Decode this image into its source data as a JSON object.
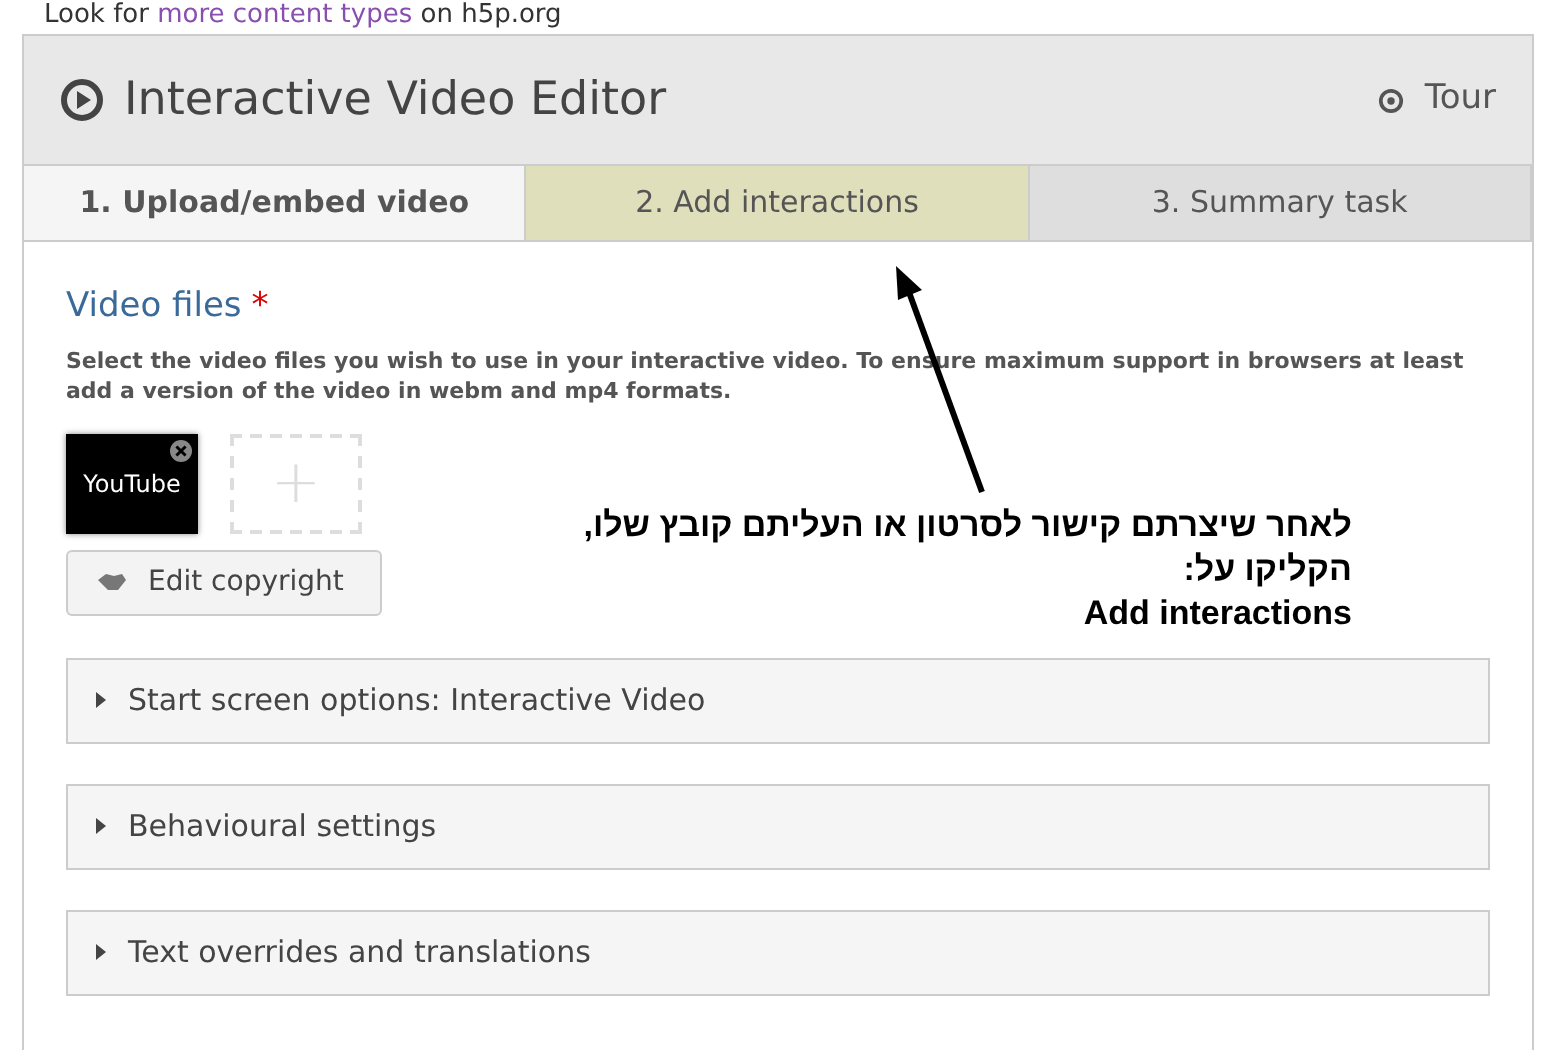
{
  "top_note": {
    "prefix": "Look for ",
    "link": "more content types",
    "suffix": " on h5p.org"
  },
  "editor": {
    "title": "Interactive Video Editor",
    "tour": "Tour"
  },
  "tabs": [
    {
      "label": "1. Upload/embed video",
      "selected": true,
      "highlighted": false
    },
    {
      "label": "2. Add interactions",
      "selected": false,
      "highlighted": true
    },
    {
      "label": "3. Summary task",
      "selected": false,
      "highlighted": false
    }
  ],
  "video_files": {
    "label": "Video files",
    "required_mark": "*",
    "description": "Select the video files you wish to use in your interactive video. To ensure maximum support in browsers at least add a version of the video in webm and mp4 formats.",
    "files": [
      {
        "name": "YouTube"
      }
    ],
    "add": "+",
    "copyright_button": "Edit copyright"
  },
  "annotation": {
    "lines": [
      "לאחר שיצרתם קישור לסרטון או העליתם קובץ שלו,",
      "הקליקו על:",
      "Add interactions"
    ]
  },
  "sections": [
    {
      "label": "Start screen options: Interactive Video",
      "expanded": false
    },
    {
      "label": "Behavioural settings",
      "expanded": false
    },
    {
      "label": "Text overrides and translations",
      "expanded": false
    }
  ]
}
